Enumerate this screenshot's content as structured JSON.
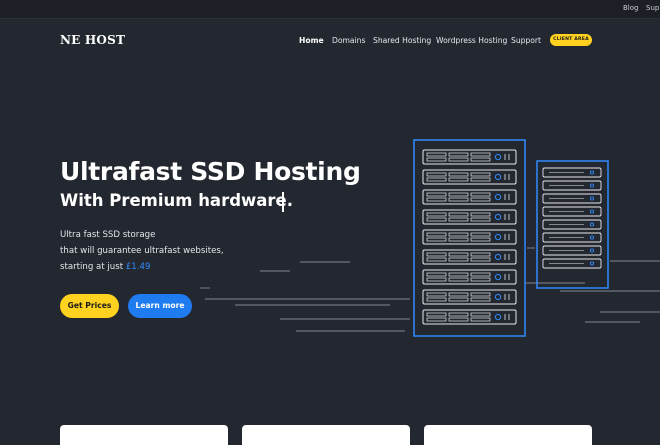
{
  "topbar": {
    "links": [
      {
        "label": "Blog"
      },
      {
        "label": "Supp"
      }
    ]
  },
  "nav": {
    "logo": "NE HOST",
    "items": [
      {
        "label": "Home",
        "active": true
      },
      {
        "label": "Domains"
      },
      {
        "label": "Shared Hosting"
      },
      {
        "label": "Wordpress Hosting"
      },
      {
        "label": "Support"
      }
    ],
    "client_button": "CLIENT AREA"
  },
  "hero": {
    "title": "Ultrafast SSD Hosting",
    "subtitle": "With Premium hardware.",
    "line1": "Ultra fast SSD storage",
    "line2": "that will guarantee ultrafast websites,",
    "line3_prefix": "starting at just ",
    "price": "£1.49",
    "primary_button": "Get Prices",
    "secondary_button": "Learn more"
  },
  "colors": {
    "background": "#23272f",
    "accent_yellow": "#ffd21f",
    "accent_blue": "#1f7cf0",
    "server_outline": "#2f8cff"
  },
  "icons": {
    "illustration": "server-rack-illustration"
  }
}
